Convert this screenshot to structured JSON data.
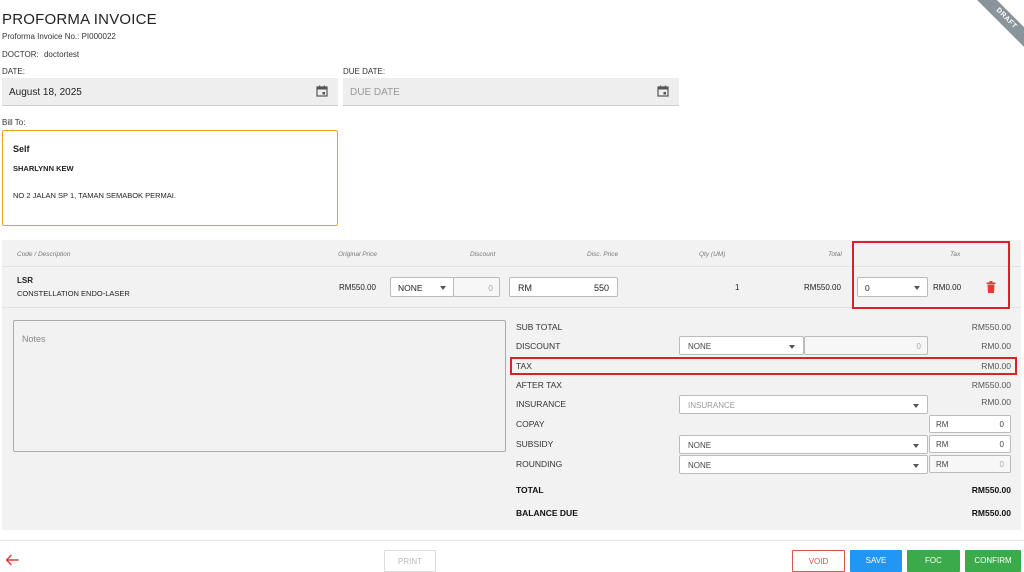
{
  "header": {
    "title": "PROFORMA INVOICE",
    "invoice_no": "Proforma Invoice No.: PI000022",
    "doctor_label": "DOCTOR:",
    "doctor_value": "doctortest",
    "draft_ribbon": "DRAFT"
  },
  "dates": {
    "date_label": "DATE:",
    "date_value": "August 18, 2025",
    "due_label": "DUE DATE:",
    "due_placeholder": "DUE DATE",
    "icon": "calendar-icon"
  },
  "bill_to": {
    "label": "Bill To:",
    "type": "Self",
    "name": "SHARLYNN KEW",
    "address": "NO 2 JALAN SP 1, TAMAN SEMABOK PERMAI."
  },
  "items_table": {
    "columns": [
      "Code / Description",
      "Original Price",
      "Discount",
      "Disc. Price",
      "Qty (UM)",
      "Total",
      "Tax"
    ],
    "rows": [
      {
        "code": "LSR",
        "description": "CONSTELLATION ENDO-LASER",
        "original_price": "RM550.00",
        "discount_type": "NONE",
        "discount_value": "0",
        "disc_price_currency": "RM",
        "disc_price_value": "550",
        "qty": "1",
        "total": "RM550.00",
        "tax_select": "0",
        "tax_amount": "RM0.00",
        "delete_icon": "trash-icon"
      }
    ]
  },
  "notes": {
    "placeholder": "Notes"
  },
  "summary": {
    "sub_total_label": "SUB TOTAL",
    "sub_total_value": "RM550.00",
    "discount_label": "DISCOUNT",
    "discount_type": "NONE",
    "discount_input": "0",
    "discount_value": "RM0.00",
    "tax_label": "TAX",
    "tax_value": "RM0.00",
    "after_tax_label": "AFTER TAX",
    "after_tax_value": "RM550.00",
    "insurance_label": "INSURANCE",
    "insurance_placeholder": "INSURANCE",
    "insurance_value": "RM0.00",
    "copay_label": "COPAY",
    "copay_currency": "RM",
    "copay_value": "0",
    "subsidy_label": "SUBSIDY",
    "subsidy_type": "NONE",
    "subsidy_currency": "RM",
    "subsidy_value": "0",
    "rounding_label": "ROUNDING",
    "rounding_type": "NONE",
    "rounding_currency": "RM",
    "rounding_value": "0",
    "total_label": "TOTAL",
    "total_value": "RM550.00",
    "balance_label": "BALANCE DUE",
    "balance_value": "RM550.00"
  },
  "footer": {
    "back_icon": "arrow-left-icon",
    "print": "PRINT",
    "void": "VOID",
    "save": "SAVE",
    "foc": "FOC",
    "confirm": "CONFIRM"
  },
  "colors": {
    "accent_orange": "#f0a020",
    "highlight_red": "#e01e25",
    "save_blue": "#2196f3",
    "confirm_green": "#3aaa4a",
    "void_red": "#d9534f"
  }
}
